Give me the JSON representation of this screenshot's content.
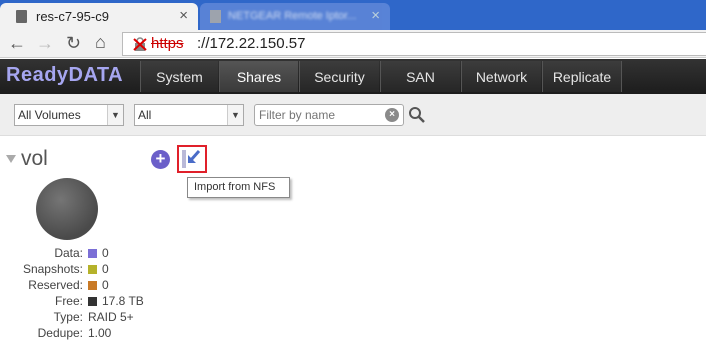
{
  "browser": {
    "active_tab_title": "res-c7-95-c9",
    "inactive_tab_title": "NETGEAR Remote Iptor...",
    "url_scheme": "https",
    "url_rest": "://172.22.150.57"
  },
  "app": {
    "logo": "ReadyDATA",
    "tabs": [
      {
        "label": "System"
      },
      {
        "label": "Shares"
      },
      {
        "label": "Security"
      },
      {
        "label": "SAN"
      },
      {
        "label": "Network"
      },
      {
        "label": "Replicate"
      }
    ],
    "active_tab": "Shares"
  },
  "filters": {
    "volume_select": "All Volumes",
    "type_select": "All",
    "filter_placeholder": "Filter by name"
  },
  "volume": {
    "name": "vol",
    "tooltip": "Import from NFS",
    "stats": [
      {
        "label": "Data:",
        "value": "0",
        "color": "#7b6fd6"
      },
      {
        "label": "Snapshots:",
        "value": "0",
        "color": "#b5b22a"
      },
      {
        "label": "Reserved:",
        "value": "0",
        "color": "#c97a26"
      },
      {
        "label": "Free:",
        "value": "17.8 TB",
        "color": "#333333"
      },
      {
        "label": "Type:",
        "value": "RAID 5+"
      },
      {
        "label": "Dedupe:",
        "value": "1.00"
      }
    ]
  }
}
